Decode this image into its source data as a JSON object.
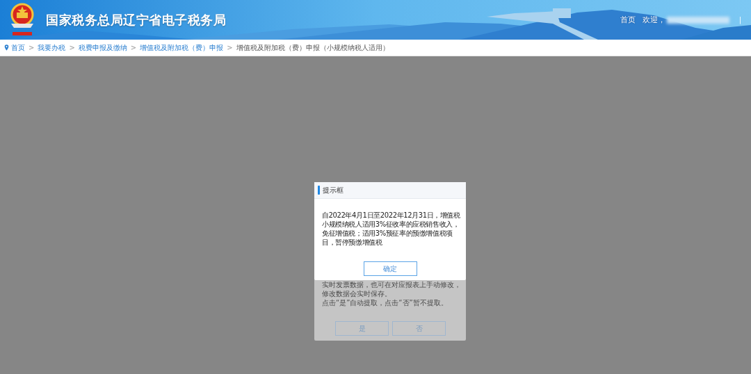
{
  "header": {
    "title": "国家税务总局辽宁省电子税务局",
    "nav_links": [
      "首页",
      "欢迎，"
    ],
    "divider": "|"
  },
  "breadcrumb": {
    "separator": ">",
    "items": [
      {
        "label": "首页",
        "current": false
      },
      {
        "label": "我要办税",
        "current": false
      },
      {
        "label": "税费申报及缴纳",
        "current": false
      },
      {
        "label": "增值税及附加税（费）申报",
        "current": false
      },
      {
        "label": "增值税及附加税（费）申报（小规模纳税人适用）",
        "current": true
      }
    ]
  },
  "background_dialog": {
    "message_lines": [
      "实时发票数据，也可在对应报表上手动修改，",
      "修改数据会实时保存。",
      "点击“是”自动提取，点击“否”暂不提取。"
    ],
    "buttons": [
      "是",
      "否"
    ]
  },
  "prompt_dialog": {
    "title": "提示框",
    "message": "自2022年4月1日至2022年12月31日，增值税小规模纳税人适用3%征收率的应税销售收入，免征增值税；适用3%预征率的预缴增值税项目，暂停预缴增值税",
    "button": "确定"
  }
}
